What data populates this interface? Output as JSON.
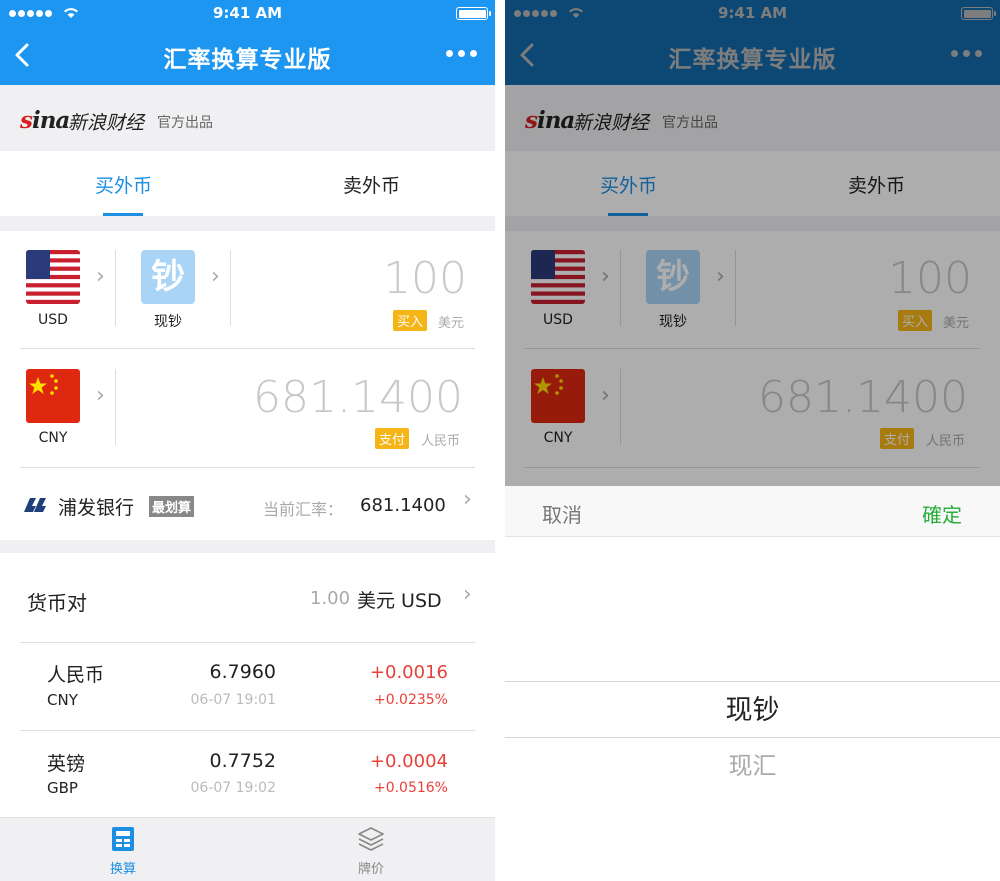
{
  "status": {
    "time": "9:41 AM"
  },
  "nav": {
    "title": "汇率换算专业版"
  },
  "brand": {
    "logo_text": "sina",
    "name": "新浪财经",
    "subtitle": "官方出品"
  },
  "tabs": [
    {
      "label": "买外币"
    },
    {
      "label": "卖外币"
    }
  ],
  "converter": {
    "from": {
      "code": "USD",
      "amount": "100",
      "tag": "买入",
      "unit": "美元"
    },
    "cash_type": {
      "icon_char": "钞",
      "label": "现钞"
    },
    "to": {
      "code": "CNY",
      "amount": "681.1400",
      "tag": "支付",
      "unit": "人民币"
    },
    "bank": {
      "name": "浦发银行",
      "badge": "最划算",
      "rate_label": "当前汇率：",
      "rate_value": "681.1400"
    }
  },
  "pairs": {
    "title": "货币对",
    "base_amount": "1.00",
    "base_currency": "美元 USD",
    "rows": [
      {
        "name": "人民币",
        "code": "CNY",
        "rate": "6.7960",
        "time": "06-07 19:01",
        "change": "+0.0016",
        "percent": "+0.0235%"
      },
      {
        "name": "英镑",
        "code": "GBP",
        "rate": "0.7752",
        "time": "06-07 19:02",
        "change": "+0.0004",
        "percent": "+0.0516%"
      }
    ]
  },
  "tabbar": [
    {
      "label": "换算",
      "icon": "calculator-icon",
      "active": true
    },
    {
      "label": "牌价",
      "icon": "layers-icon",
      "active": false
    }
  ],
  "picker": {
    "cancel": "取消",
    "confirm": "確定",
    "options": [
      "现钞",
      "现汇"
    ],
    "selected": "现钞"
  },
  "colors": {
    "nav_blue": "#1c96f0",
    "nav_blue_dimmed": "#14609a",
    "accent": "#1c8fe3",
    "tag_yellow": "#f6b516",
    "red": "#e8413a",
    "green": "#27ae3a"
  }
}
